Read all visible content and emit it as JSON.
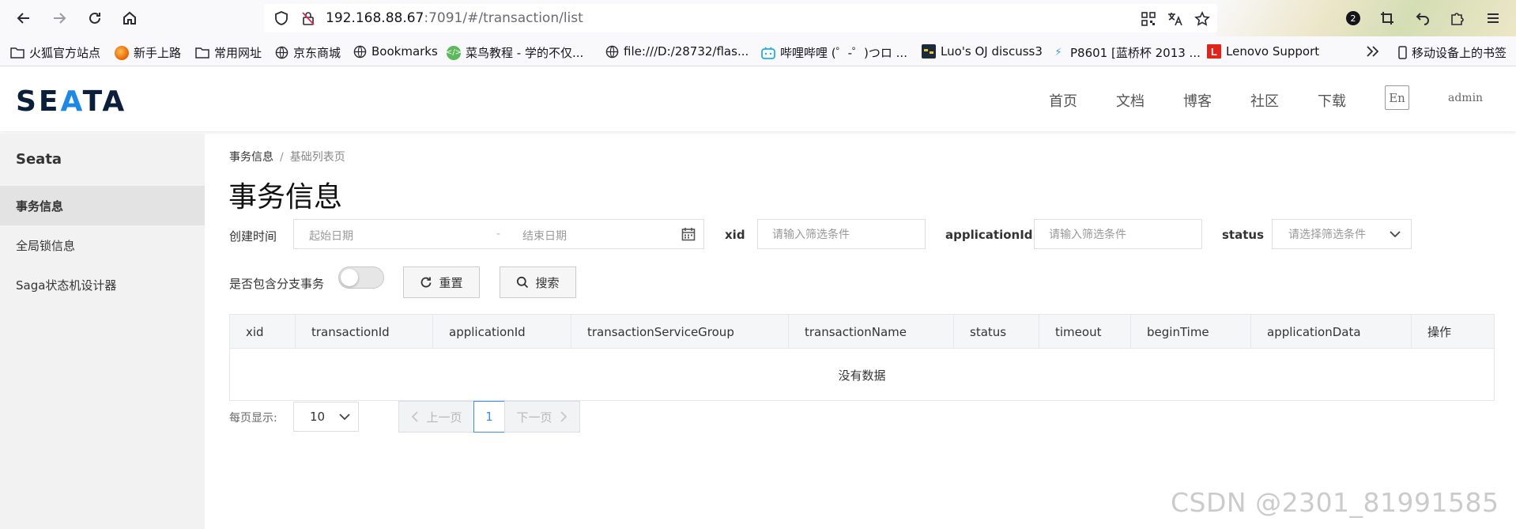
{
  "browser": {
    "url_host": "192.168.88.67",
    "url_rest": ":7091/#/transaction/list",
    "extensions_badge": "2"
  },
  "bookmarks": {
    "items": [
      {
        "label": "火狐官方站点",
        "icon": "folder-icon"
      },
      {
        "label": "新手上路",
        "icon": "firefox-icon"
      },
      {
        "label": "常用网址",
        "icon": "folder-icon"
      },
      {
        "label": "京东商城",
        "icon": "globe-icon"
      },
      {
        "label": "Bookmarks",
        "icon": "globe-icon"
      },
      {
        "label": "菜鸟教程 - 学的不仅...",
        "icon": "runoob-icon"
      },
      {
        "label": "file:///D:/28732/flas...",
        "icon": "globe-icon"
      },
      {
        "label": "哔哩哔哩 (゜-゜)つロ ...",
        "icon": "bilibili-icon"
      },
      {
        "label": "Luo's OJ discuss3",
        "icon": "oj-icon"
      },
      {
        "label": "P8601 [蓝桥杯 2013 ...",
        "icon": "luogu-icon"
      },
      {
        "label": "Lenovo Support",
        "icon": "lenovo-icon"
      }
    ],
    "mobile_label": "移动设备上的书签"
  },
  "header": {
    "logo_pre": "SE",
    "logo_a": "A",
    "logo_post": "TA",
    "menu": [
      "首页",
      "文档",
      "博客",
      "社区",
      "下载"
    ],
    "lang": "En",
    "user": "admin"
  },
  "sidebar": {
    "title": "Seata",
    "items": [
      {
        "label": "事务信息",
        "active": true
      },
      {
        "label": "全局锁信息",
        "active": false
      },
      {
        "label": "Saga状态机设计器",
        "active": false
      }
    ]
  },
  "breadcrumb": {
    "parent": "事务信息",
    "separator": "/",
    "current": "基础列表页"
  },
  "page_title": "事务信息",
  "filters": {
    "created_label": "创建时间",
    "start_placeholder": "起始日期",
    "range_dash": "-",
    "end_placeholder": "结束日期",
    "xid_label": "xid",
    "xid_placeholder": "请输入筛选条件",
    "app_label": "applicationId",
    "app_placeholder": "请输入筛选条件",
    "status_label": "status",
    "status_placeholder": "请选择筛选条件",
    "branch_label": "是否包含分支事务",
    "branch_on": false,
    "reset": "重置",
    "search": "搜索"
  },
  "table": {
    "columns": [
      "xid",
      "transactionId",
      "applicationId",
      "transactionServiceGroup",
      "transactionName",
      "status",
      "timeout",
      "beginTime",
      "applicationData",
      "操作"
    ],
    "empty_text": "没有数据"
  },
  "pagination": {
    "page_size_label": "每页显示:",
    "page_size": "10",
    "prev": "上一页",
    "current": "1",
    "next": "下一页"
  },
  "watermark": "CSDN @2301_81991585"
}
